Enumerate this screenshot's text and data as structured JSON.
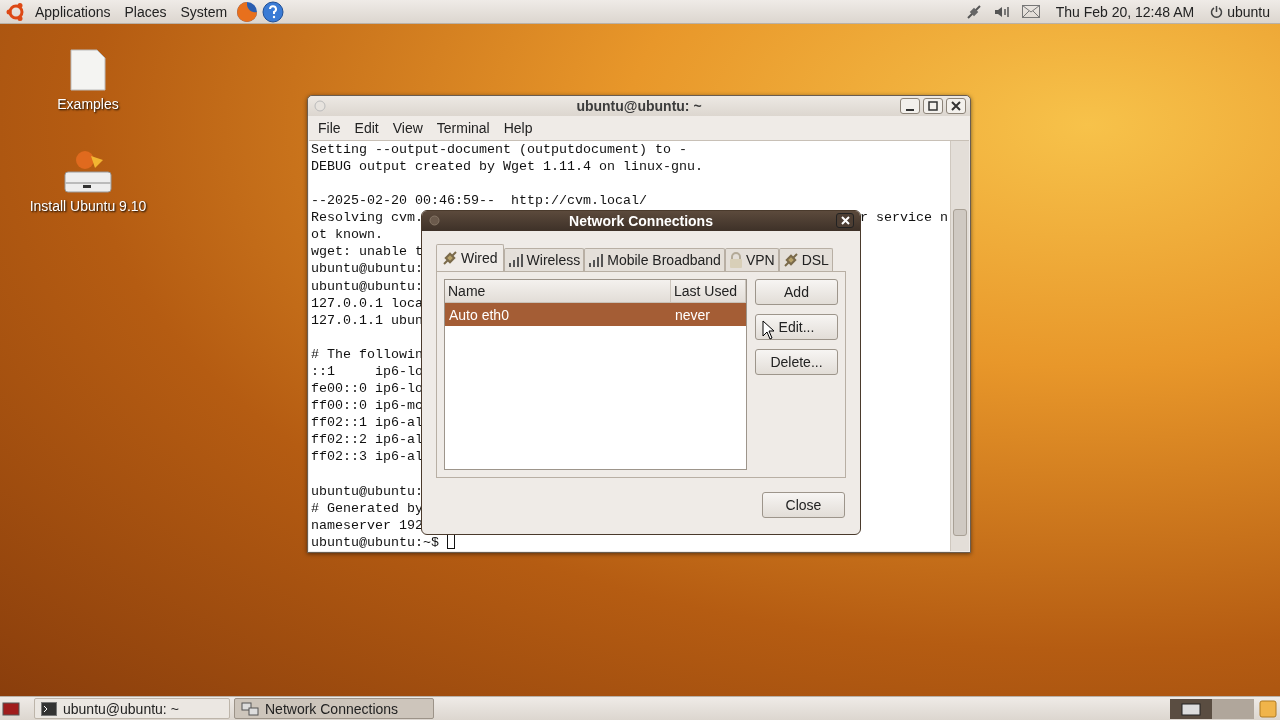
{
  "top_panel": {
    "menus": [
      "Applications",
      "Places",
      "System"
    ],
    "clock": "Thu Feb 20, 12:48 AM",
    "user": "ubuntu"
  },
  "desktop_icons": [
    {
      "label": "Examples",
      "kind": "document"
    },
    {
      "label": "Install Ubuntu 9.10",
      "kind": "installer"
    }
  ],
  "terminal": {
    "title": "ubuntu@ubuntu: ~",
    "menu": [
      "File",
      "Edit",
      "View",
      "Terminal",
      "Help"
    ],
    "lines": [
      {
        "kind": "text",
        "text": "Setting --output-document (outputdocument) to -"
      },
      {
        "kind": "text",
        "text": "DEBUG output created by Wget 1.11.4 on linux-gnu."
      },
      {
        "kind": "blank"
      },
      {
        "kind": "text",
        "text": "--2025-02-20 00:46:59--  http://cvm.local/"
      },
      {
        "kind": "text",
        "text": "Resolving cvm.",
        "tail": "r service n"
      },
      {
        "kind": "text",
        "text": "ot known."
      },
      {
        "kind": "text",
        "text": "wget: unable t"
      },
      {
        "kind": "text",
        "text": "ubuntu@ubuntu:"
      },
      {
        "kind": "text",
        "text": "ubuntu@ubuntu:"
      },
      {
        "kind": "text",
        "text": "127.0.0.1 loca"
      },
      {
        "kind": "text",
        "text": "127.0.1.1 ubun"
      },
      {
        "kind": "blank"
      },
      {
        "kind": "text",
        "text": "# The followin"
      },
      {
        "kind": "text",
        "text": "::1     ip6-lo"
      },
      {
        "kind": "text",
        "text": "fe00::0 ip6-lo"
      },
      {
        "kind": "text",
        "text": "ff00::0 ip6-mc"
      },
      {
        "kind": "text",
        "text": "ff02::1 ip6-al"
      },
      {
        "kind": "text",
        "text": "ff02::2 ip6-al"
      },
      {
        "kind": "text",
        "text": "ff02::3 ip6-al"
      },
      {
        "kind": "blank"
      },
      {
        "kind": "text",
        "text": "ubuntu@ubuntu:"
      },
      {
        "kind": "text",
        "text": "# Generated by"
      },
      {
        "kind": "text",
        "text": "nameserver 192"
      },
      {
        "kind": "prompt",
        "text": "ubuntu@ubuntu:~$"
      }
    ]
  },
  "dialog": {
    "title": "Network Connections",
    "tabs": [
      {
        "label": "Wired",
        "kind": "plug",
        "selected": true
      },
      {
        "label": "Wireless",
        "kind": "bars",
        "selected": false
      },
      {
        "label": "Mobile Broadband",
        "kind": "bars",
        "selected": false
      },
      {
        "label": "VPN",
        "kind": "lock",
        "selected": false
      },
      {
        "label": "DSL",
        "kind": "plug",
        "selected": false
      }
    ],
    "columns": [
      "Name",
      "Last Used"
    ],
    "rows": [
      {
        "name": "Auto eth0",
        "last_used": "never",
        "selected": true
      }
    ],
    "buttons": [
      "Add",
      "Edit...",
      "Delete..."
    ],
    "close": "Close"
  },
  "taskbar": [
    {
      "label": "ubuntu@ubuntu: ~",
      "kind": "terminal",
      "selected": false
    },
    {
      "label": "Network Connections",
      "kind": "network",
      "selected": true
    }
  ]
}
